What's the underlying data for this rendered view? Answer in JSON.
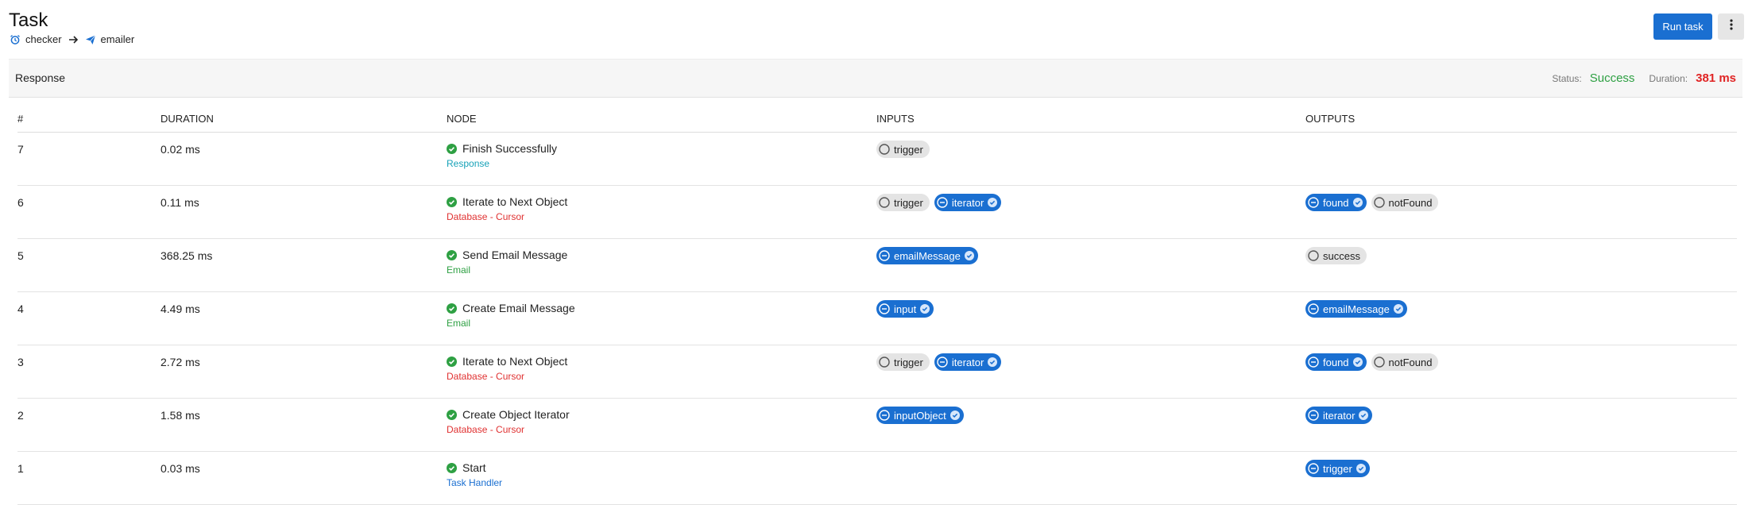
{
  "header": {
    "title": "Task",
    "source_name": "checker",
    "target_name": "emailer",
    "run_button_label": "Run task"
  },
  "response": {
    "label": "Response",
    "status_label": "Status:",
    "status_value": "Success",
    "duration_label": "Duration:",
    "duration_value": "381 ms"
  },
  "table": {
    "columns": [
      "#",
      "DURATION",
      "NODE",
      "INPUTS",
      "OUTPUTS"
    ],
    "rows": [
      {
        "num": "7",
        "duration": "0.02 ms",
        "node": "Finish Successfully",
        "type": "Response",
        "type_color": "teal",
        "inputs": [
          {
            "label": "trigger",
            "active": false
          }
        ],
        "outputs": []
      },
      {
        "num": "6",
        "duration": "0.11 ms",
        "node": "Iterate to Next Object",
        "type": "Database - Cursor",
        "type_color": "red",
        "inputs": [
          {
            "label": "trigger",
            "active": false
          },
          {
            "label": "iterator",
            "active": true
          }
        ],
        "outputs": [
          {
            "label": "found",
            "active": true
          },
          {
            "label": "notFound",
            "active": false
          }
        ]
      },
      {
        "num": "5",
        "duration": "368.25 ms",
        "node": "Send Email Message",
        "type": "Email",
        "type_color": "green",
        "inputs": [
          {
            "label": "emailMessage",
            "active": true
          }
        ],
        "outputs": [
          {
            "label": "success",
            "active": false
          }
        ]
      },
      {
        "num": "4",
        "duration": "4.49 ms",
        "node": "Create Email Message",
        "type": "Email",
        "type_color": "green",
        "inputs": [
          {
            "label": "input",
            "active": true
          }
        ],
        "outputs": [
          {
            "label": "emailMessage",
            "active": true
          }
        ]
      },
      {
        "num": "3",
        "duration": "2.72 ms",
        "node": "Iterate to Next Object",
        "type": "Database - Cursor",
        "type_color": "red",
        "inputs": [
          {
            "label": "trigger",
            "active": false
          },
          {
            "label": "iterator",
            "active": true
          }
        ],
        "outputs": [
          {
            "label": "found",
            "active": true
          },
          {
            "label": "notFound",
            "active": false
          }
        ]
      },
      {
        "num": "2",
        "duration": "1.58 ms",
        "node": "Create Object Iterator",
        "type": "Database - Cursor",
        "type_color": "red",
        "inputs": [
          {
            "label": "inputObject",
            "active": true
          }
        ],
        "outputs": [
          {
            "label": "iterator",
            "active": true
          }
        ]
      },
      {
        "num": "1",
        "duration": "0.03 ms",
        "node": "Start",
        "type": "Task Handler",
        "type_color": "blue",
        "inputs": [],
        "outputs": [
          {
            "label": "trigger",
            "active": true
          }
        ]
      }
    ]
  },
  "icons": {
    "source": "alarm-clock-icon",
    "arrow": "arrow-right-icon",
    "target": "paper-plane-icon",
    "more": "vertical-dots-icon",
    "node_status": "check-circle-icon",
    "pill_active": "minus-circle-icon",
    "pill_inactive": "empty-circle-icon",
    "pill_check": "check-badge-icon"
  },
  "colors": {
    "accent": "#1a6fd1",
    "success": "#2ea043",
    "duration": "#e02424",
    "type_teal": "#17a2b8",
    "type_red": "#e03131",
    "type_green": "#2ea043",
    "type_blue": "#1a6fd1"
  }
}
